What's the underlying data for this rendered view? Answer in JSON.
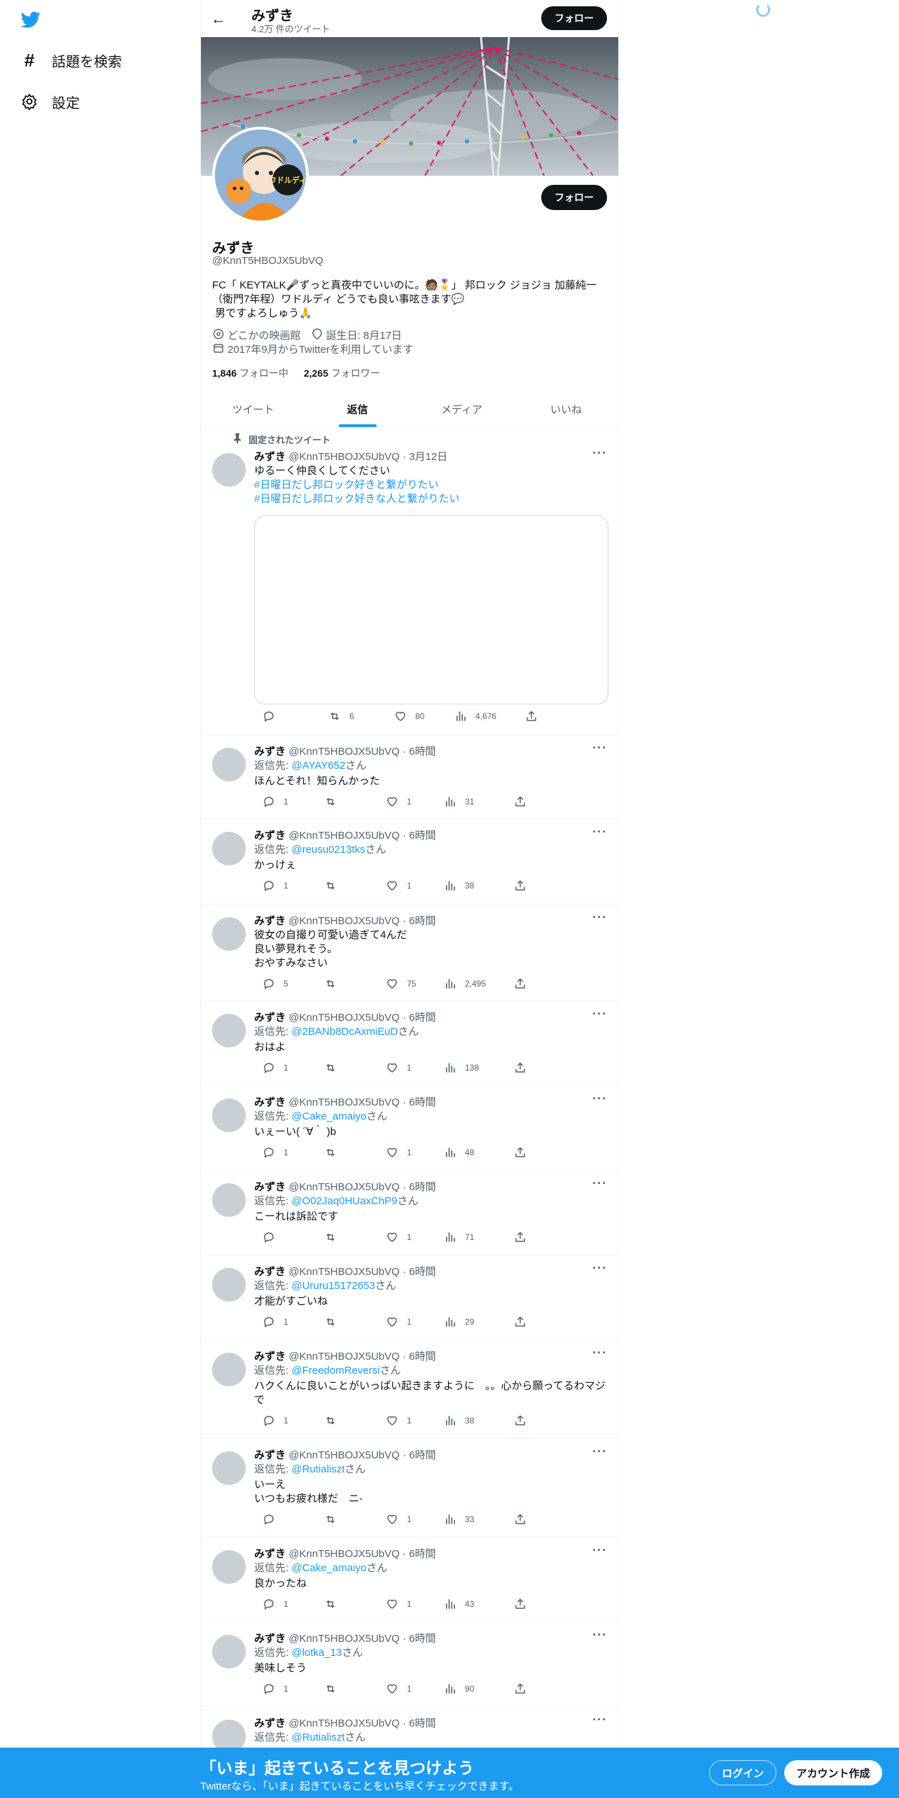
{
  "nav": {
    "explore_label": "話題を検索",
    "settings_label": "設定",
    "logo_icon": "twitter-bird-icon",
    "explore_icon": "hashtag-icon",
    "settings_icon": "gear-icon"
  },
  "colors": {
    "accent": "#1d9bf0",
    "text": "#0f1419",
    "muted": "#536471",
    "banner_flag": "#e0185e"
  },
  "header": {
    "name": "みずき",
    "tweet_count": "4.2万 件のツイート",
    "follow_label": "フォロー"
  },
  "profile": {
    "name": "みずき",
    "handle": "@KnnT5HBOJX5UbVQ",
    "bio_line1": "FC「 KEYTALK🎤ずっと真夜中でいいのに。🧑🏽🎖️」 邦ロック ジョジョ 加藤純一",
    "bio_line2": "（衛門7年程）ワドルディ どうでも良い事呟きます💬",
    "bio_line3": " 男ですよろしゅう🙏",
    "location": "どこかの映画館",
    "birthday": "誕生日: 8月17日",
    "joined": "2017年9月からTwitterを利用しています",
    "following_count": "1,846",
    "following_label": "フォロー中",
    "followers_count": "2,265",
    "followers_label": "フォロワー",
    "follow_label": "フォロー",
    "avatar_text": "ワドルディ"
  },
  "tabs": [
    {
      "label": "ツイート"
    },
    {
      "label": "返信",
      "active": true
    },
    {
      "label": "メディア"
    },
    {
      "label": "いいね"
    }
  ],
  "pinned_label": "固定されたツイート",
  "reply_prefix": "返信先: ",
  "reply_suffix": "さん",
  "tweets": [
    {
      "name": "みずき",
      "meta": "@KnnT5HBOJX5UbVQ · 3月12日",
      "lines": [
        "ゆるーく仲良くしてください"
      ],
      "tags": [
        "#日曜日だし邦ロック好きと繋がりたい",
        "#日曜日だし邦ロック好きな人と繋がりたい"
      ],
      "replies": "",
      "retweets": "6",
      "likes": "80",
      "views": "4,676"
    },
    {
      "name": "みずき",
      "meta": "@KnnT5HBOJX5UbVQ · 6時間",
      "reply_to": "@AYAY652",
      "lines": [
        "ほんとそれ！知らんかった"
      ],
      "replies": "1",
      "retweets": "",
      "likes": "1",
      "views": "31"
    },
    {
      "name": "みずき",
      "meta": "@KnnT5HBOJX5UbVQ · 6時間",
      "reply_to": "@reusu0213tks",
      "lines": [
        "かっけぇ"
      ],
      "replies": "1",
      "retweets": "",
      "likes": "1",
      "views": "38"
    },
    {
      "name": "みずき",
      "meta": "@KnnT5HBOJX5UbVQ · 6時間",
      "lines": [
        "彼女の自撮り可愛い過ぎて4んだ",
        "良い夢見れそう。",
        "おやすみなさい"
      ],
      "replies": "5",
      "retweets": "",
      "likes": "75",
      "views": "2,495"
    },
    {
      "name": "みずき",
      "meta": "@KnnT5HBOJX5UbVQ · 6時間",
      "reply_to": "@2BANb8DcAxmiEuD",
      "lines": [
        "おはよ"
      ],
      "replies": "1",
      "retweets": "",
      "likes": "1",
      "views": "138"
    },
    {
      "name": "みずき",
      "meta": "@KnnT5HBOJX5UbVQ · 6時間",
      "reply_to": "@Cake_amaiyo",
      "lines": [
        "いぇーい( ´∀｀ )b"
      ],
      "replies": "1",
      "retweets": "",
      "likes": "1",
      "views": "48"
    },
    {
      "name": "みずき",
      "meta": "@KnnT5HBOJX5UbVQ · 6時間",
      "reply_to": "@O02Jaq0HUaxChP9",
      "lines": [
        "こーれは訴訟です"
      ],
      "replies": "",
      "retweets": "",
      "likes": "1",
      "views": "71"
    },
    {
      "name": "みずき",
      "meta": "@KnnT5HBOJX5UbVQ · 6時間",
      "reply_to": "@Ururu15172653",
      "lines": [
        "才能がすごいね"
      ],
      "replies": "1",
      "retweets": "",
      "likes": "1",
      "views": "29"
    },
    {
      "name": "みずき",
      "meta": "@KnnT5HBOJX5UbVQ · 6時間",
      "reply_to": "@FreedomReversi",
      "lines": [
        "ハクくんに良いことがいっぱい起きますように　。。心から願ってるわマジ",
        "で"
      ],
      "replies": "1",
      "retweets": "",
      "likes": "1",
      "views": "38"
    },
    {
      "name": "みずき",
      "meta": "@KnnT5HBOJX5UbVQ · 6時間",
      "reply_to": "@Rutialiszt",
      "lines": [
        "いーえ",
        "いつもお疲れ様だ　ニ-"
      ],
      "replies": "",
      "retweets": "",
      "likes": "1",
      "views": "33"
    },
    {
      "name": "みずき",
      "meta": "@KnnT5HBOJX5UbVQ · 6時間",
      "reply_to": "@Cake_amaiyo",
      "lines": [
        "良かったね"
      ],
      "replies": "1",
      "retweets": "",
      "likes": "1",
      "views": "43"
    },
    {
      "name": "みずき",
      "meta": "@KnnT5HBOJX5UbVQ · 6時間",
      "reply_to": "@lotka_13",
      "lines": [
        "美味しそう"
      ],
      "replies": "1",
      "retweets": "",
      "likes": "1",
      "views": "90"
    },
    {
      "name": "みずき",
      "meta": "@KnnT5HBOJX5UbVQ · 6時間",
      "reply_to": "@Rutialiszt",
      "lines": [],
      "replies": "",
      "retweets": "",
      "likes": "",
      "views": ""
    }
  ],
  "bottom": {
    "title": "「いま」起きていることを見つけよう",
    "subtitle": "Twitterなら、「いま」起きていることをいち早くチェックできます。",
    "login_label": "ログイン",
    "signup_label": "アカウント作成"
  }
}
